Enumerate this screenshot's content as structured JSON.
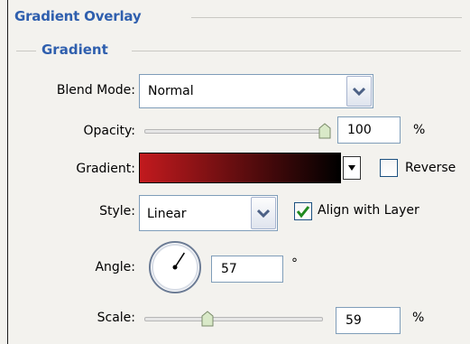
{
  "section": {
    "title": "Gradient Overlay",
    "subtitle": "Gradient"
  },
  "blend_mode": {
    "label": "Blend Mode:",
    "value": "Normal"
  },
  "opacity": {
    "label": "Opacity:",
    "value": "100",
    "unit": "%",
    "level": 1.0
  },
  "gradient": {
    "label": "Gradient:",
    "colors": [
      "#c21a1e",
      "#000000"
    ],
    "reverse_label": "Reverse",
    "reverse_checked": false
  },
  "style": {
    "label": "Style:",
    "value": "Linear",
    "align_label": "Align with Layer",
    "align_checked": true
  },
  "angle": {
    "label": "Angle:",
    "value": "57",
    "unit": "°",
    "degrees": 57
  },
  "scale": {
    "label": "Scale:",
    "value": "59",
    "unit": "%",
    "level": 0.59
  },
  "colors": {
    "heading": "#2f5fae",
    "field_border": "#7f9db9",
    "check_green": "#1f8a1f"
  }
}
